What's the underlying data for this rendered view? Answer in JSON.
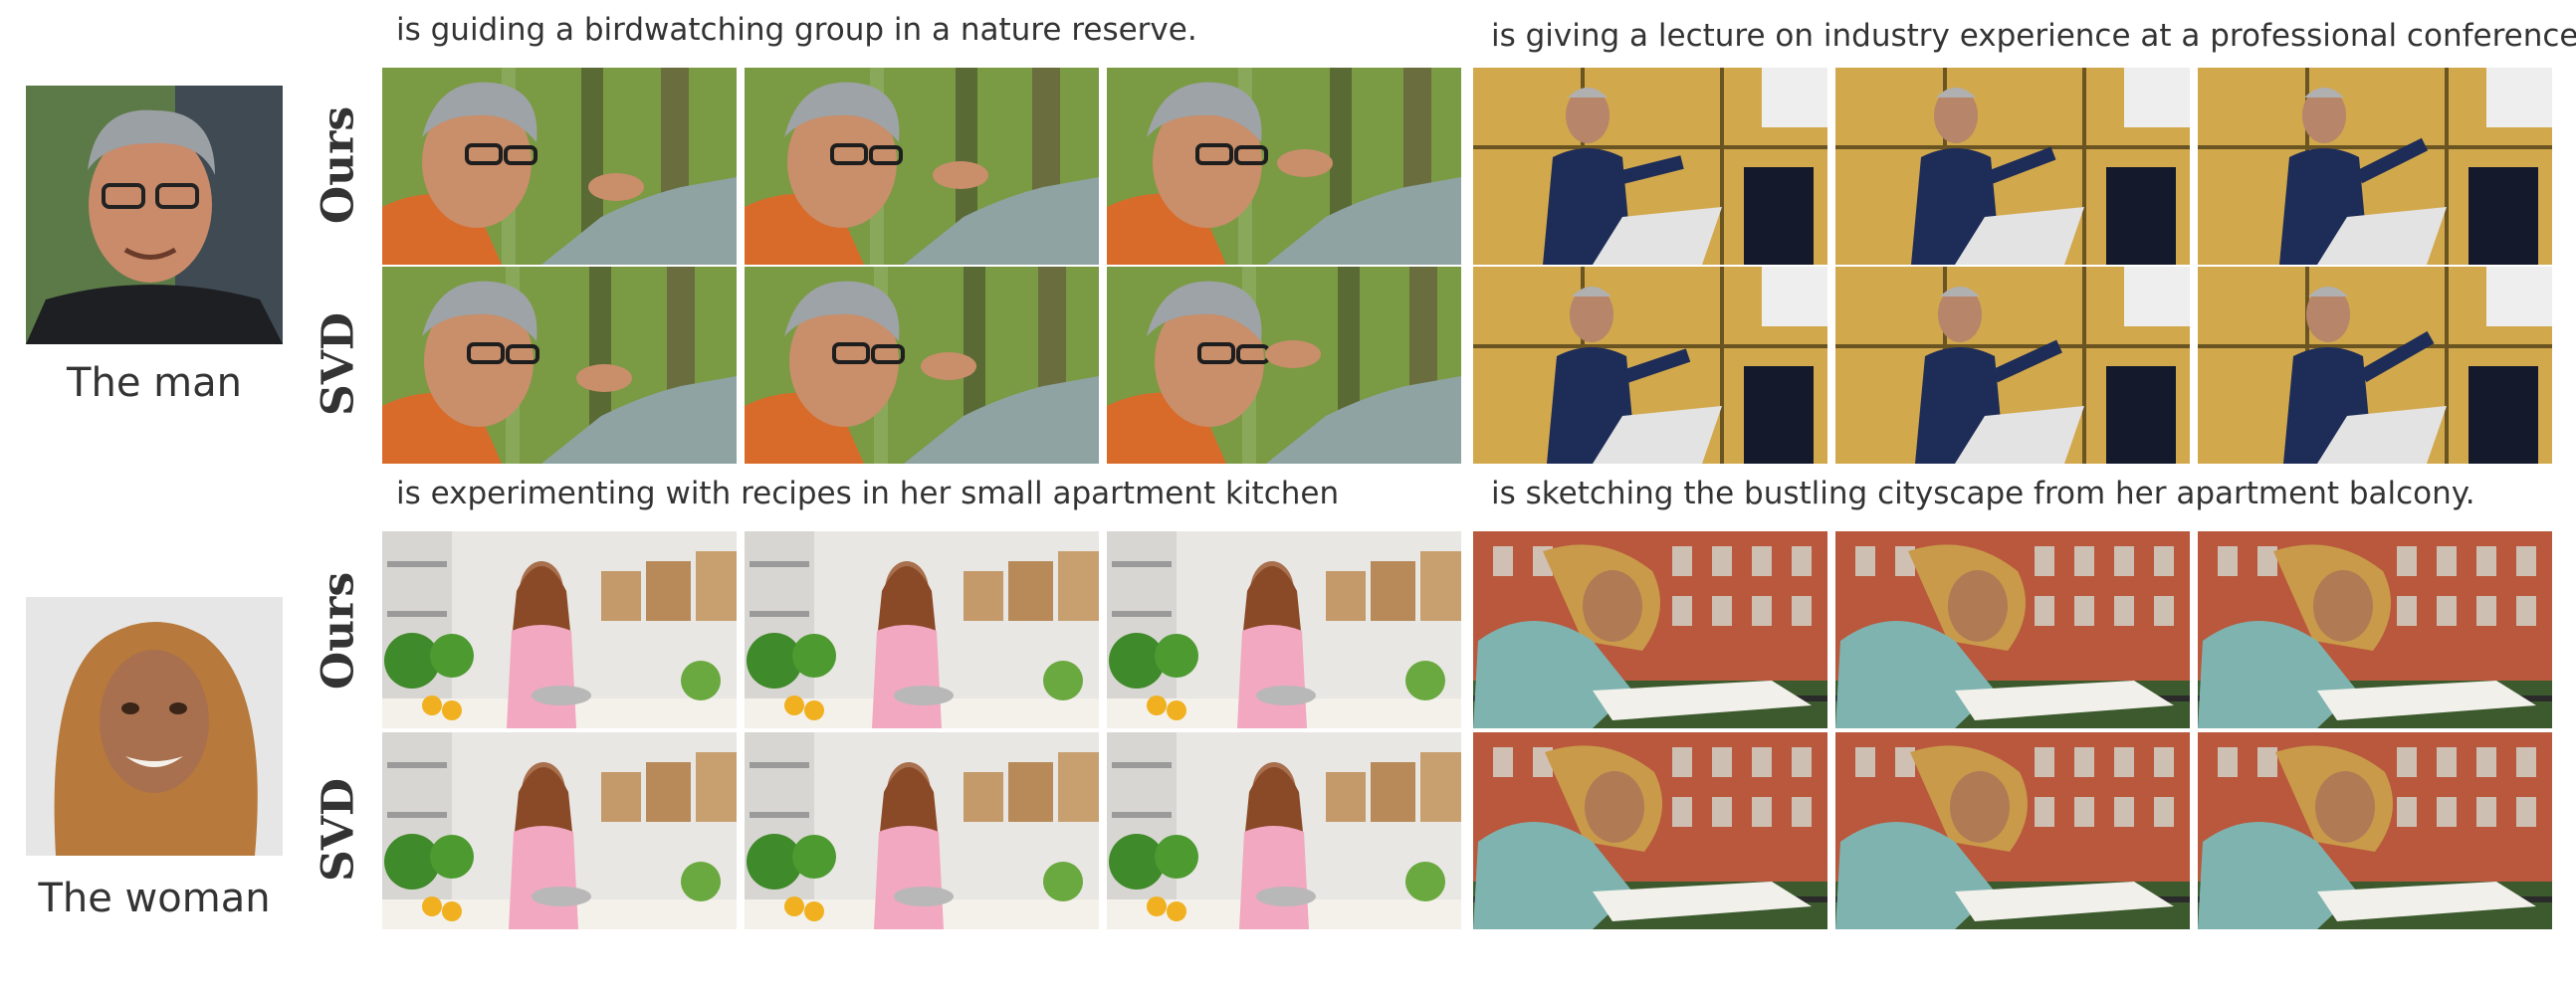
{
  "subjects": [
    {
      "name": "The man",
      "panels": [
        {
          "caption": "is guiding a birdwatching group in a nature reserve."
        },
        {
          "caption": "is giving a lecture on industry experience at a professional conference"
        }
      ]
    },
    {
      "name": "The woman",
      "panels": [
        {
          "caption": "is experimenting with recipes in her small apartment kitchen"
        },
        {
          "caption": "is sketching the bustling cityscape from her apartment balcony."
        }
      ]
    }
  ],
  "row_labels": {
    "ours": "Ours",
    "svd": "SVD"
  },
  "colors": {
    "forest": "#6f8f3a",
    "stage": "#c9a24a",
    "kitchen": "#e8e6e2",
    "brick": "#b5553a"
  }
}
